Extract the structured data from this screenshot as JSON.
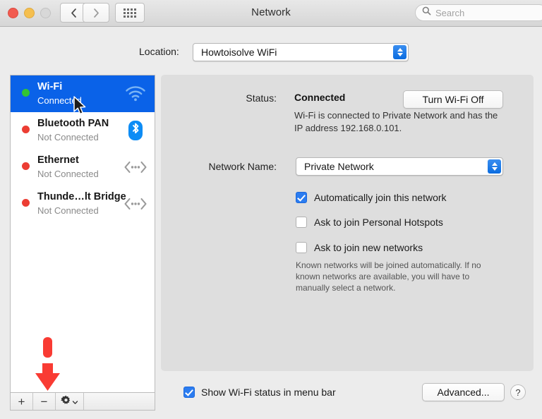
{
  "window": {
    "title": "Network",
    "traffic_lights": [
      "close",
      "minimize",
      "zoom"
    ],
    "nav": {
      "back": "back-arrow",
      "forward": "forward-arrow",
      "grid": "show-all-grid"
    },
    "search": {
      "placeholder": "Search",
      "icon": "search-icon"
    }
  },
  "location": {
    "label": "Location:",
    "value": "Howtoisolve WiFi"
  },
  "sidebar": {
    "items": [
      {
        "name": "Wi-Fi",
        "status": "Connected",
        "dot": "green",
        "icon": "wifi-icon",
        "selected": true
      },
      {
        "name": "Bluetooth PAN",
        "status": "Not Connected",
        "dot": "red",
        "icon": "bluetooth-icon",
        "selected": false
      },
      {
        "name": "Ethernet",
        "status": "Not Connected",
        "dot": "red",
        "icon": "ethernet-icon",
        "selected": false
      },
      {
        "name": "Thunde…lt Bridge",
        "status": "Not Connected",
        "dot": "red",
        "icon": "thunderbolt-icon",
        "selected": false
      }
    ],
    "toolbar": {
      "add": "+",
      "remove": "−",
      "actions": "gear-icon",
      "actions_caret": "chevron-down-icon"
    }
  },
  "main": {
    "status_label": "Status:",
    "status_value": "Connected",
    "turn_off_button": "Turn Wi-Fi Off",
    "status_description": "Wi-Fi is connected to Private Network and has the IP address 192.168.0.101.",
    "network_name_label": "Network Name:",
    "network_name_value": "Private Network",
    "checkboxes": [
      {
        "label": "Automatically join this network",
        "checked": true
      },
      {
        "label": "Ask to join Personal Hotspots",
        "checked": false
      },
      {
        "label": "Ask to join new networks",
        "checked": false
      }
    ],
    "note": "Known networks will be joined automatically. If no known networks are available, you will have to manually select a network."
  },
  "footer": {
    "show_status_label": "Show Wi-Fi status in menu bar",
    "show_status_checked": true,
    "advanced_button": "Advanced...",
    "help_button": "?"
  },
  "annotation": {
    "type": "red-down-arrow",
    "points_at": "remove-interface-button",
    "color": "#f93b33"
  },
  "colors": {
    "selection_blue": "#0a62e8",
    "accent_blue": "#2b7cf0",
    "panel_gray": "#dedede",
    "window_gray": "#ececec",
    "status_green": "#32c533",
    "status_red": "#ec3d33"
  }
}
